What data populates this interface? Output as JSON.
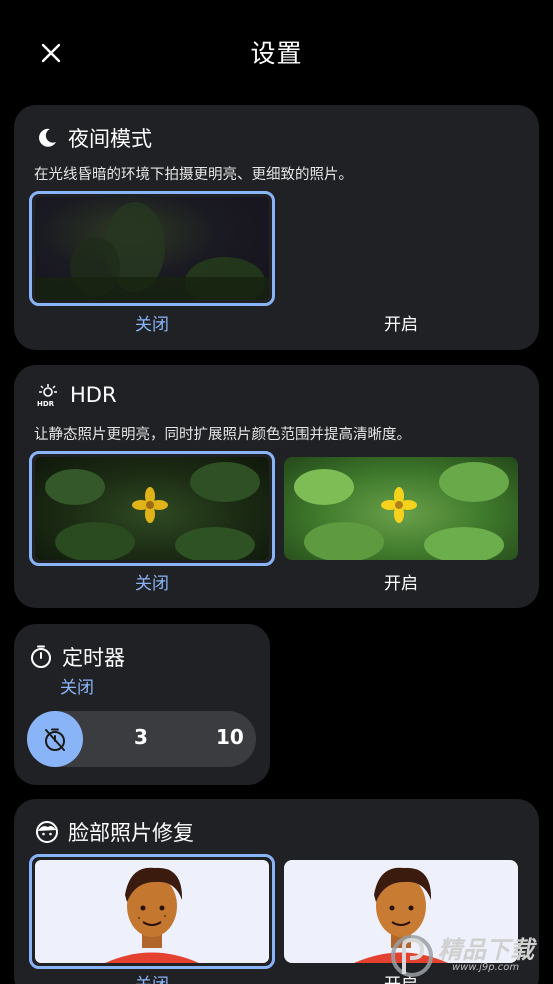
{
  "header": {
    "title": "设置",
    "close_icon": "close-icon"
  },
  "night": {
    "title": "夜间模式",
    "icon": "moon-icon",
    "description": "在光线昏暗的环境下拍摄更明亮、更细致的照片。",
    "options": [
      {
        "label": "关闭",
        "selected": true
      },
      {
        "label": "开启",
        "selected": false
      }
    ]
  },
  "hdr": {
    "title": "HDR",
    "icon": "hdr-icon",
    "description": "让静态照片更明亮，同时扩展照片颜色范围并提高清晰度。",
    "options": [
      {
        "label": "关闭",
        "selected": true
      },
      {
        "label": "开启",
        "selected": false
      }
    ]
  },
  "timer": {
    "title": "定时器",
    "icon": "timer-icon",
    "status": "关闭",
    "options": [
      {
        "label": "timer-off-icon",
        "selected": true
      },
      {
        "label": "3"
      },
      {
        "label": "10"
      }
    ]
  },
  "face": {
    "title": "脸部照片修复",
    "icon": "face-icon",
    "options": [
      {
        "label": "关闭",
        "selected": true
      },
      {
        "label": "开启",
        "selected": false
      }
    ]
  },
  "watermark": {
    "text": "精品下载",
    "url": "www.j9p.com"
  },
  "colors": {
    "accent": "#8ab4f8",
    "card": "#202124",
    "background": "#000000"
  }
}
